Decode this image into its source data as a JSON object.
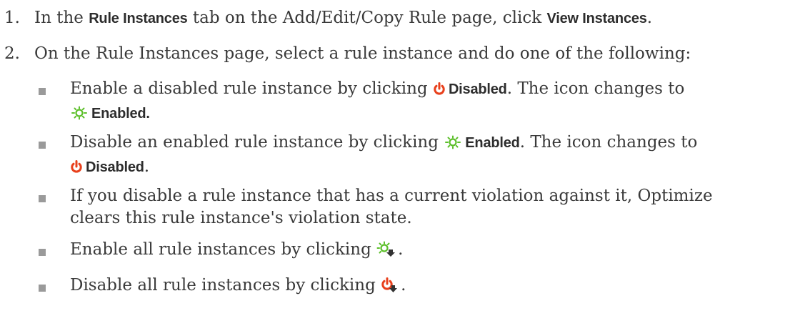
{
  "steps": [
    {
      "number": "1.",
      "pre": "In the ",
      "ui1": "Rule Instances",
      "mid": " tab on the Add/Edit/Copy Rule page, click ",
      "ui2": "View Instances",
      "post": "."
    },
    {
      "number": "2.",
      "text": "On the Rule Instances page, select a rule instance and do one of the following:"
    }
  ],
  "bullets": [
    {
      "pre": "Enable a disabled rule instance by clicking ",
      "ui1": "Disabled",
      "mid": ". The icon changes to",
      "ui2": "Enabled."
    },
    {
      "pre": "Disable an enabled rule instance by clicking ",
      "ui1": "Enabled",
      "mid": ". The icon changes to",
      "ui2": "Disabled",
      "post": "."
    },
    {
      "line1": "If you disable a rule instance that has a current violation against it, Optimize",
      "line2": "clears this rule instance's violation state."
    },
    {
      "pre": "Enable all rule instances by clicking ",
      "post": "."
    },
    {
      "pre": "Disable all rule instances by clicking ",
      "post": "."
    }
  ],
  "icons": {
    "disabled": "power-disabled-icon",
    "enabled": "light-enabled-icon",
    "enable_all": "enable-all-icon",
    "disable_all": "disable-all-icon"
  },
  "colors": {
    "text": "#3a3a3a",
    "bullet": "#9a9a9a",
    "disabled_red": "#e8401c",
    "enabled_green": "#5cbf2a"
  }
}
